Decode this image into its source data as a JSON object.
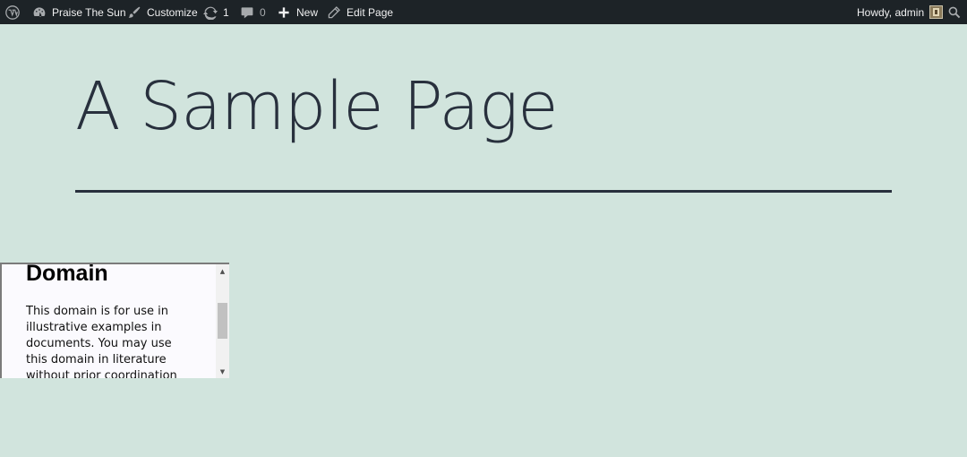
{
  "admin_bar": {
    "wp_logo_icon": "wordpress-icon",
    "site_name": "Praise The Sun",
    "customize": "Customize",
    "updates_count": "1",
    "comments_count": "0",
    "new_label": "New",
    "edit_page": "Edit Page",
    "greeting": "Howdy, admin"
  },
  "page": {
    "title": "A Sample Page"
  },
  "embed": {
    "heading": "Domain",
    "paragraph": "This domain is for use in illustrative examples in documents. You may use this domain in literature without prior coordination or asking for permission."
  },
  "colors": {
    "background": "#d1e4dd",
    "admin_bar": "#1d2327",
    "text": "#28303d"
  }
}
